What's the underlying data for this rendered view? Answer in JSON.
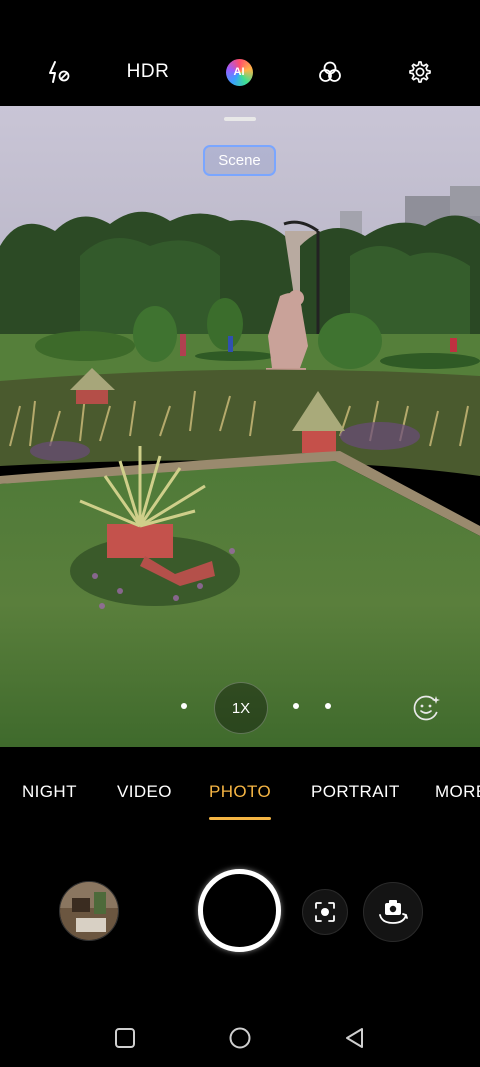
{
  "toolbar": {
    "flash_icon": "flash-off-icon",
    "hdr_label": "HDR",
    "ai_label": "AI",
    "filter_icon": "filters-icon",
    "settings_icon": "gear-icon"
  },
  "viewfinder": {
    "scene_label": "Scene",
    "zoom_label": "1X"
  },
  "modes": {
    "items": [
      "NIGHT",
      "VIDEO",
      "PHOTO",
      "PORTRAIT",
      "MORE"
    ],
    "active": "PHOTO"
  },
  "colors": {
    "accent": "#f5b544",
    "background": "#000000"
  },
  "nav": {
    "recents_icon": "square-recents-icon",
    "home_icon": "circle-home-icon",
    "back_icon": "triangle-back-icon"
  }
}
